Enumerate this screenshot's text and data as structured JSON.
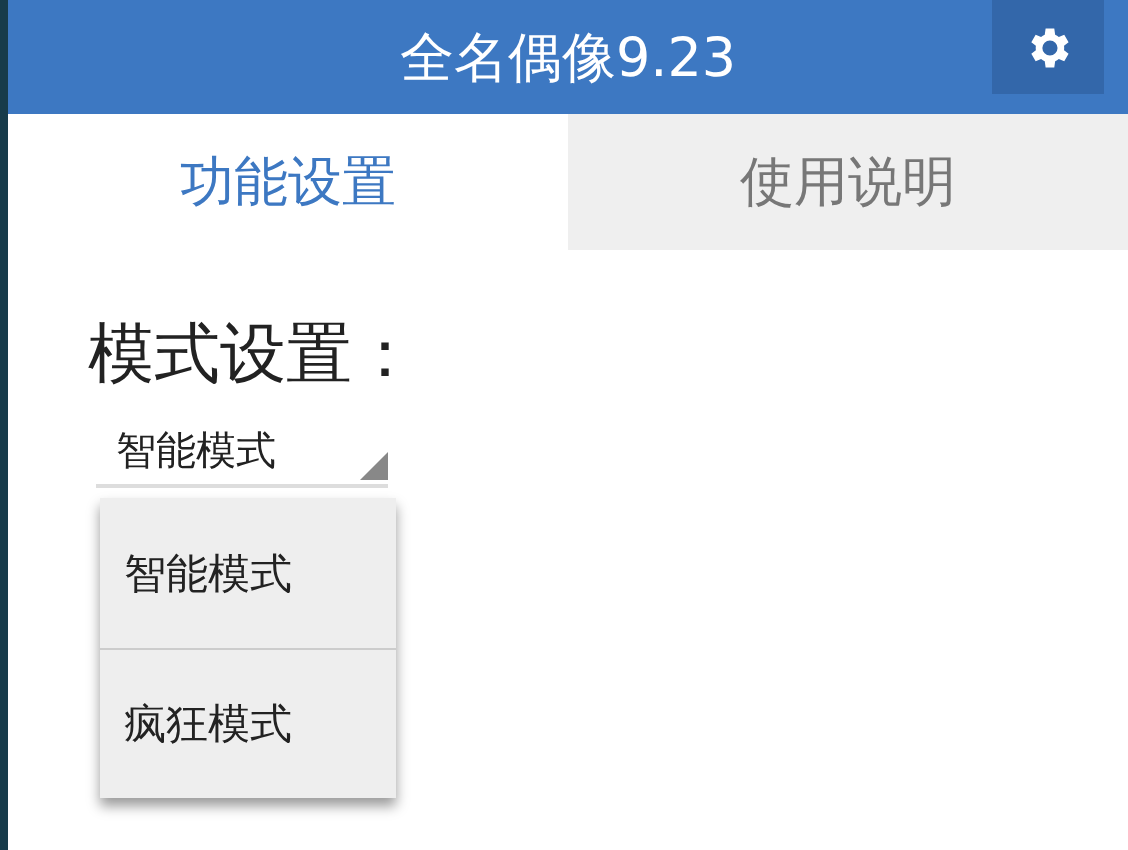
{
  "window": {
    "title": "全名偶像9.23"
  },
  "tabs": [
    {
      "label": "功能设置",
      "selected": true
    },
    {
      "label": "使用说明",
      "selected": false
    }
  ],
  "section_title": "模式设置：",
  "mode_dropdown": {
    "value": "智能模式",
    "expanded": true,
    "options": [
      "智能模式",
      "疯狂模式"
    ]
  }
}
